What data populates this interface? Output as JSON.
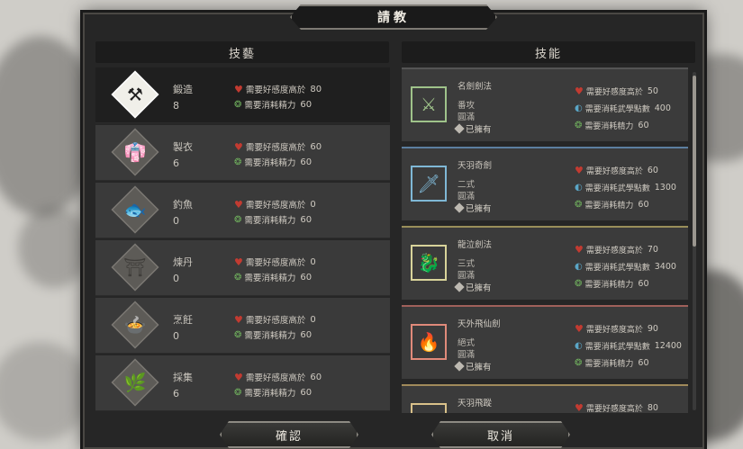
{
  "title": "請教",
  "left_header": "技藝",
  "right_header": "技能",
  "crafts": [
    {
      "name": "鍛造",
      "level": "8",
      "icon": "anvil-icon",
      "glyph": "⚒",
      "req1": "需要好感度高於",
      "req1_val": "80",
      "req2": "需要消耗精力",
      "req2_val": "60"
    },
    {
      "name": "製衣",
      "level": "6",
      "icon": "clothing-icon",
      "glyph": "👘",
      "req1": "需要好感度高於",
      "req1_val": "60",
      "req2": "需要消耗精力",
      "req2_val": "60"
    },
    {
      "name": "釣魚",
      "level": "0",
      "icon": "fish-icon",
      "glyph": "🐟",
      "req1": "需要好感度高於",
      "req1_val": "0",
      "req2": "需要消耗精力",
      "req2_val": "60"
    },
    {
      "name": "煉丹",
      "level": "0",
      "icon": "pavilion-icon",
      "glyph": "⛩",
      "req1": "需要好感度高於",
      "req1_val": "0",
      "req2": "需要消耗精力",
      "req2_val": "60"
    },
    {
      "name": "烹飪",
      "level": "0",
      "icon": "cooking-bowl-icon",
      "glyph": "🍲",
      "req1": "需要好感度高於",
      "req1_val": "0",
      "req2": "需要消耗精力",
      "req2_val": "60"
    },
    {
      "name": "採集",
      "level": "6",
      "icon": "herb-icon",
      "glyph": "🌿",
      "req1": "需要好感度高於",
      "req1_val": "60",
      "req2": "需要消耗精力",
      "req2_val": "60"
    }
  ],
  "moves": [
    {
      "name": "名劍劍法",
      "tier": "番攻",
      "mastery": "圓滿",
      "owned": "已擁有",
      "icon": "green-sword-skill-icon",
      "glyph": "⚔",
      "color": "#9fc38a",
      "req1": "需要好感度高於",
      "req1_val": "50",
      "req2": "需要消耗武學點數",
      "req2_val": "400",
      "req3": "需要消耗精力",
      "req3_val": "60"
    },
    {
      "name": "天羽奇劍",
      "tier": "二式",
      "mastery": "圓滿",
      "owned": "已擁有",
      "icon": "blue-sword-skill-icon",
      "glyph": "🗡",
      "color": "#7fb8d6",
      "req1": "需要好感度高於",
      "req1_val": "60",
      "req2": "需要消耗武學點數",
      "req2_val": "1300",
      "req3": "需要消耗精力",
      "req3_val": "60"
    },
    {
      "name": "龍泣劍法",
      "tier": "三式",
      "mastery": "圓滿",
      "owned": "已擁有",
      "icon": "yellow-dragon-skill-icon",
      "glyph": "🐉",
      "color": "#d8d39a",
      "req1": "需要好感度高於",
      "req1_val": "70",
      "req2": "需要消耗武學點數",
      "req2_val": "3400",
      "req3": "需要消耗精力",
      "req3_val": "60"
    },
    {
      "name": "天外飛仙劍",
      "tier": "絕式",
      "mastery": "圓滿",
      "owned": "已擁有",
      "icon": "red-sword-skill-icon",
      "glyph": "🔥",
      "color": "#e08a7a",
      "req1": "需要好感度高於",
      "req1_val": "90",
      "req2": "需要消耗武學點數",
      "req2_val": "12400",
      "req3": "需要消耗精力",
      "req3_val": "60"
    },
    {
      "name": "天羽飛蹤",
      "tier": "",
      "mastery": "",
      "owned": "",
      "icon": "gold-skill-icon",
      "glyph": "✦",
      "color": "#d9c18a",
      "req1": "需要好感度高於",
      "req1_val": "80",
      "req2": "",
      "req2_val": "",
      "req3": "",
      "req3_val": ""
    }
  ],
  "buttons": {
    "confirm": "確認",
    "cancel": "取消"
  }
}
